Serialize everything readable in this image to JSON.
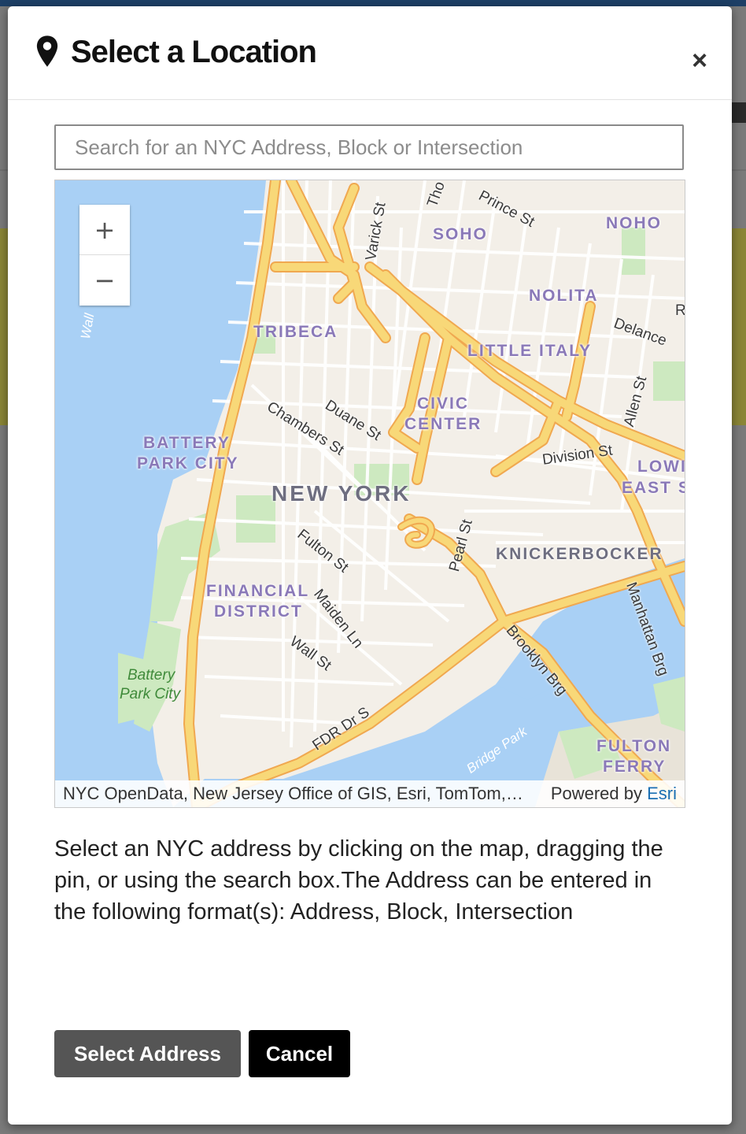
{
  "dialog": {
    "title": "Select a Location",
    "close_symbol": "×",
    "header_icon": "map-pin-icon"
  },
  "search": {
    "placeholder": "Search for an NYC Address, Block or Intersection",
    "value": ""
  },
  "map": {
    "zoom_in_label": "+",
    "zoom_out_label": "−",
    "neighborhood_labels": {
      "soho": "SOHO",
      "noho": "NOHO",
      "nolita": "NOLITA",
      "tribeca": "TRIBECA",
      "little_italy": "LITTLE ITALY",
      "civic": "CIVIC",
      "center": "CENTER",
      "battery": "BATTERY",
      "park_city": "PARK CITY",
      "lower": "LOWI",
      "east": "EAST S",
      "financial": "FINANCIAL",
      "district": "DISTRICT",
      "knickerbocker": "KNICKERBOCKER",
      "fulton": "FULTON",
      "ferry": "FERRY"
    },
    "city_label": "NEW YORK",
    "street_labels": {
      "varick": "Varick St",
      "thompson": "Tho",
      "prince": "Prince St",
      "r_edge": "R",
      "delancey": "Delance",
      "allen": "Allen St",
      "duane": "Duane St",
      "chambers": "Chambers St",
      "division": "Division St",
      "fulton": "Fulton St",
      "pearl": "Pearl St",
      "maiden": "Maiden Ln",
      "wall": "Wall St",
      "brooklyn_brg": "Brooklyn Brg",
      "manhattan_brg": "Manhattan Brg",
      "fdr": "FDR Dr S"
    },
    "park_label_1": "Battery",
    "park_label_2": "Park City",
    "water_labels": {
      "wall": "Wall",
      "bridge_park": "Bridge Park"
    },
    "attribution": "NYC OpenData, New Jersey Office of GIS, Esri, TomTom, Garmin, SafeGraph, METI/NASA, USGS, EPA, NPS, USDA",
    "powered_by": "Powered by ",
    "esri": "Esri"
  },
  "help_text": "Select an NYC address by clicking on the map, dragging the pin, or using the search box.The Address can be entered in the following format(s): Address, Block, Intersection",
  "buttons": {
    "select": "Select Address",
    "cancel": "Cancel"
  },
  "colors": {
    "water": "#a9d0f5",
    "park": "#cde9c0",
    "land": "#f3efe8",
    "highway": "#f8d878",
    "highway_casing": "#f0a850",
    "select_button": "#555555",
    "cancel_button": "#000000",
    "esri_link": "#1a6fb3"
  }
}
